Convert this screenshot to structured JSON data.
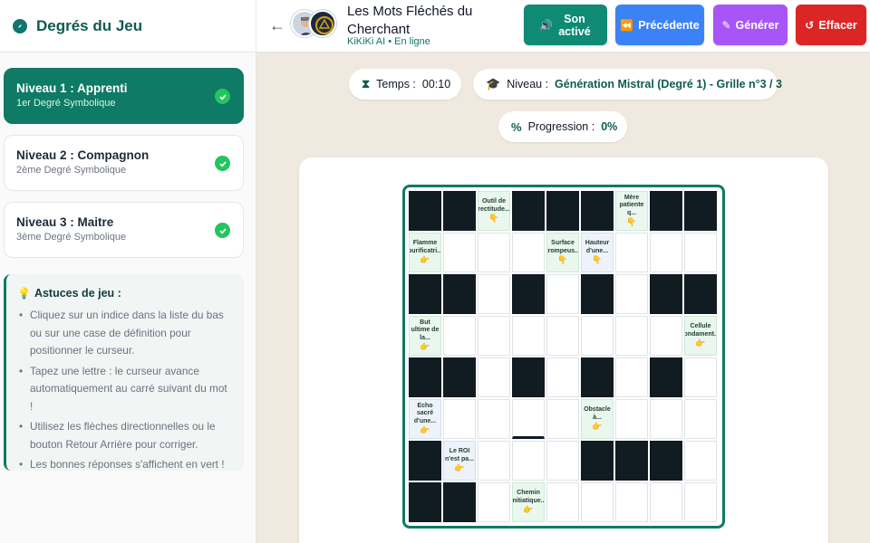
{
  "sidebar": {
    "title": "Degrés du Jeu",
    "levels": [
      {
        "title": "Niveau 1 : Apprenti",
        "subtitle": "1er Degré Symbolique"
      },
      {
        "title": "Niveau 2 : Compagnon",
        "subtitle": "2ème Degré Symbolique"
      },
      {
        "title": "Niveau 3 : Maitre",
        "subtitle": "3ème Degré Symbolique"
      }
    ],
    "tips": {
      "title": "Astuces de jeu :",
      "items": [
        "Cliquez sur un indice dans la liste du bas ou sur une case de définition pour positionner le curseur.",
        "Tapez une lettre : le curseur avance automatiquement au carré suivant du mot !",
        "Utilisez les flèches directionnelles ou le bouton Retour Arrière pour corriger.",
        "Les bonnes réponses s'affichent en vert !"
      ]
    }
  },
  "header": {
    "chat_title": "Les Mots Fléchés du Cherchant",
    "chat_subtitle": "KiKiKi AI • En ligne",
    "buttons": {
      "sound": "Son activé",
      "previous": "Précédente",
      "generate": "Générer",
      "clear": "Effacer"
    }
  },
  "status": {
    "time_label": "Temps :",
    "time_value": "00:10",
    "level_label": "Niveau :",
    "level_value": "Génération Mistral (Degré 1) - Grille n°3 / 3",
    "progress_label": "Progression :",
    "progress_value": "0%"
  },
  "grid": {
    "rows": 8,
    "cols": 9,
    "hand_icon": "👇",
    "right_icon": "👉",
    "cells": [
      [
        "B",
        "B",
        {
          "t": "Outil de rectitude...",
          "d": "down"
        },
        "B",
        "B",
        "B",
        {
          "t": "Mère patiente q...",
          "d": "down"
        },
        "B",
        "B"
      ],
      [
        {
          "t": "Flamme purificatri...",
          "d": "right"
        },
        "W",
        "W",
        "W",
        {
          "t": "Surface trompeus...",
          "d": "down"
        },
        {
          "t": "Hauteur d'une...",
          "d": "down",
          "c": "blue"
        },
        "W",
        "W",
        "W"
      ],
      [
        "B",
        "B",
        "W",
        "B",
        "W",
        "B",
        "W",
        "B",
        "B"
      ],
      [
        {
          "t": "But ultime de la...",
          "d": "right"
        },
        "W",
        "W",
        "W",
        "W",
        "W",
        "W",
        "W",
        {
          "t": "Cellule fondament...",
          "d": "right"
        }
      ],
      [
        "B",
        "B",
        "W",
        "B",
        "W",
        "B",
        "W",
        "B",
        "W"
      ],
      [
        {
          "t": "Echo sacré d'une...",
          "d": "right",
          "c": "blue"
        },
        "W",
        "W",
        "C",
        "W",
        {
          "t": "Obstacle à...",
          "d": "right"
        },
        "W",
        "W",
        "W"
      ],
      [
        "B",
        {
          "t": "Le ROI n'est pa...",
          "d": "right",
          "c": "blue"
        },
        "W",
        "W",
        "W",
        "B",
        "B",
        "B",
        "W"
      ],
      [
        "B",
        "B",
        "W",
        {
          "t": "Chemin initiatique...",
          "d": "right"
        },
        "W",
        "W",
        "W",
        "W",
        "W"
      ]
    ]
  },
  "colors": {
    "primary": "#0f7a65",
    "blue_button": "#3b82f6",
    "purple_button": "#a855f7",
    "red_button": "#dc2626",
    "check_green": "#22c55e"
  }
}
